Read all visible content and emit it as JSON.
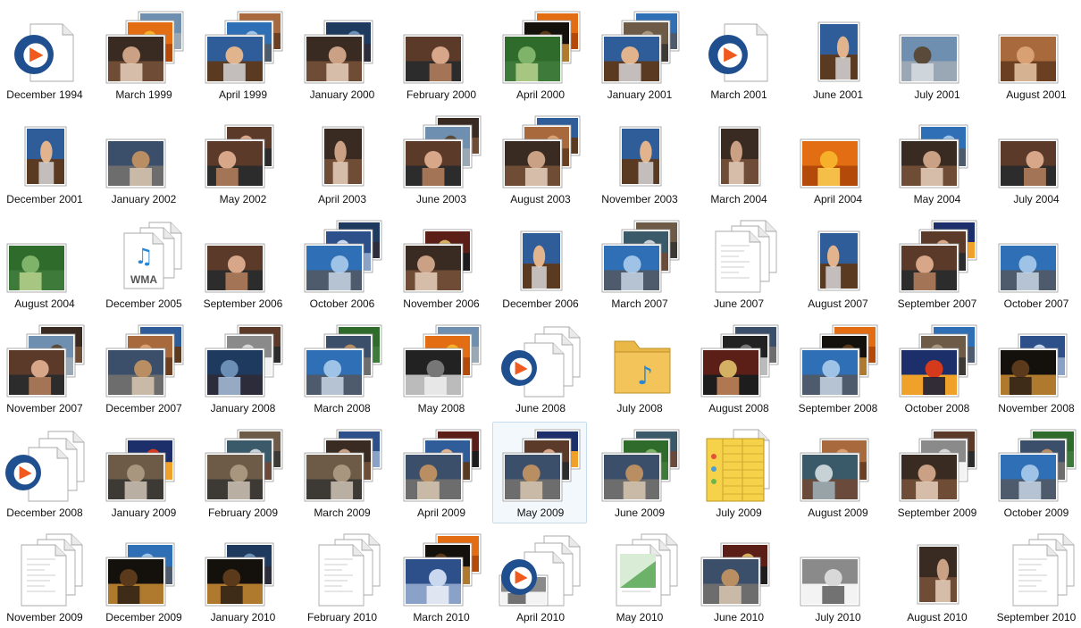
{
  "window": {
    "view": "Large icons"
  },
  "colors": {
    "selection_bg": "#f3f8fc",
    "selection_border": "#c7dcea",
    "folder": "#f2c45a",
    "media_blue": "#1f4f8f",
    "media_orange": "#f05a1e"
  },
  "selected_index": 49,
  "items": [
    {
      "label": "December 1994",
      "icon": "media-player-file-icon",
      "photos": 0,
      "kind": "media"
    },
    {
      "label": "March 1999",
      "icon": "photo-stack-icon",
      "photos": 3,
      "kind": "portrait"
    },
    {
      "label": "April 1999",
      "icon": "photo-stack-icon",
      "photos": 3,
      "kind": "child"
    },
    {
      "label": "January 2000",
      "icon": "photo-stack-icon",
      "photos": 2,
      "kind": "portrait"
    },
    {
      "label": "February 2000",
      "icon": "photo-stack-icon",
      "photos": 1,
      "kind": "people"
    },
    {
      "label": "April 2000",
      "icon": "photo-stack-icon",
      "photos": 3,
      "kind": "nature"
    },
    {
      "label": "January 2001",
      "icon": "photo-stack-icon",
      "photos": 3,
      "kind": "child"
    },
    {
      "label": "March 2001",
      "icon": "media-player-file-icon",
      "photos": 0,
      "kind": "media"
    },
    {
      "label": "June 2001",
      "icon": "photo-icon",
      "photos": 1,
      "kind": "child"
    },
    {
      "label": "July 2001",
      "icon": "photo-icon",
      "photos": 1,
      "kind": "outdoor"
    },
    {
      "label": "August 2001",
      "icon": "photo-icon",
      "photos": 1,
      "kind": "animal"
    },
    {
      "label": "December 2001",
      "icon": "photo-icon",
      "photos": 1,
      "kind": "child"
    },
    {
      "label": "January 2002",
      "icon": "photo-icon",
      "photos": 1,
      "kind": "indoor"
    },
    {
      "label": "May 2002",
      "icon": "photo-stack-icon",
      "photos": 2,
      "kind": "people"
    },
    {
      "label": "April 2003",
      "icon": "photo-icon",
      "photos": 1,
      "kind": "portrait"
    },
    {
      "label": "June 2003",
      "icon": "photo-stack-icon",
      "photos": 3,
      "kind": "people"
    },
    {
      "label": "August 2003",
      "icon": "photo-stack-icon",
      "photos": 3,
      "kind": "portrait"
    },
    {
      "label": "November 2003",
      "icon": "photo-icon",
      "photos": 1,
      "kind": "child"
    },
    {
      "label": "March 2004",
      "icon": "photo-icon",
      "photos": 1,
      "kind": "portrait"
    },
    {
      "label": "April 2004",
      "icon": "photo-icon",
      "photos": 1,
      "kind": "flowers"
    },
    {
      "label": "May 2004",
      "icon": "photo-stack-icon",
      "photos": 2,
      "kind": "portrait"
    },
    {
      "label": "July 2004",
      "icon": "photo-icon",
      "photos": 1,
      "kind": "people"
    },
    {
      "label": "August 2004",
      "icon": "photo-icon",
      "photos": 1,
      "kind": "nature"
    },
    {
      "label": "December 2005",
      "icon": "wma-audio-file-icon",
      "photos": 0,
      "kind": "wma",
      "badge": "WMA"
    },
    {
      "label": "September 2006",
      "icon": "photo-icon",
      "photos": 1,
      "kind": "people"
    },
    {
      "label": "October 2006",
      "icon": "photo-stack-icon",
      "photos": 3,
      "kind": "city"
    },
    {
      "label": "November 2006",
      "icon": "photo-stack-icon",
      "photos": 2,
      "kind": "portrait"
    },
    {
      "label": "December 2006",
      "icon": "photo-icon",
      "photos": 1,
      "kind": "child"
    },
    {
      "label": "March 2007",
      "icon": "photo-stack-icon",
      "photos": 3,
      "kind": "city"
    },
    {
      "label": "June 2007",
      "icon": "document-stack-icon",
      "photos": 0,
      "kind": "doc"
    },
    {
      "label": "August 2007",
      "icon": "photo-icon",
      "photos": 1,
      "kind": "child"
    },
    {
      "label": "September 2007",
      "icon": "photo-stack-icon",
      "photos": 3,
      "kind": "people"
    },
    {
      "label": "October 2007",
      "icon": "photo-icon",
      "photos": 1,
      "kind": "city"
    },
    {
      "label": "November 2007",
      "icon": "photo-stack-icon",
      "photos": 3,
      "kind": "people"
    },
    {
      "label": "December 2007",
      "icon": "photo-stack-icon",
      "photos": 3,
      "kind": "indoor"
    },
    {
      "label": "January 2008",
      "icon": "photo-stack-icon",
      "photos": 3,
      "kind": "water"
    },
    {
      "label": "March 2008",
      "icon": "photo-stack-icon",
      "photos": 3,
      "kind": "city"
    },
    {
      "label": "May 2008",
      "icon": "photo-stack-icon",
      "photos": 3,
      "kind": "bw"
    },
    {
      "label": "June 2008",
      "icon": "media-player-stack-icon",
      "photos": 0,
      "kind": "media-stack"
    },
    {
      "label": "July 2008",
      "icon": "music-folder-icon",
      "photos": 0,
      "kind": "folder"
    },
    {
      "label": "August 2008",
      "icon": "album-art-stack-icon",
      "photos": 3,
      "kind": "album"
    },
    {
      "label": "September 2008",
      "icon": "photo-stack-icon",
      "photos": 3,
      "kind": "city"
    },
    {
      "label": "October 2008",
      "icon": "album-art-stack-icon",
      "photos": 3,
      "kind": "album2"
    },
    {
      "label": "November 2008",
      "icon": "photo-stack-icon",
      "photos": 2,
      "kind": "night"
    },
    {
      "label": "December 2008",
      "icon": "media-player-stack-icon",
      "photos": 0,
      "kind": "media-stack"
    },
    {
      "label": "January 2009",
      "icon": "photo-stack-icon",
      "photos": 2,
      "kind": "construction"
    },
    {
      "label": "February 2009",
      "icon": "photo-stack-icon",
      "photos": 3,
      "kind": "construction"
    },
    {
      "label": "March 2009",
      "icon": "photo-stack-icon",
      "photos": 3,
      "kind": "construction"
    },
    {
      "label": "April 2009",
      "icon": "photo-stack-icon",
      "photos": 3,
      "kind": "indoor"
    },
    {
      "label": "May 2009",
      "icon": "photo-stack-icon",
      "photos": 3,
      "kind": "indoor"
    },
    {
      "label": "June 2009",
      "icon": "photo-stack-icon",
      "photos": 3,
      "kind": "indoor"
    },
    {
      "label": "July 2009",
      "icon": "spreadsheet-stack-icon",
      "photos": 0,
      "kind": "sheet"
    },
    {
      "label": "August 2009",
      "icon": "album-art-stack-icon",
      "photos": 2,
      "kind": "album3"
    },
    {
      "label": "September 2009",
      "icon": "photo-stack-icon",
      "photos": 3,
      "kind": "portrait"
    },
    {
      "label": "October 2009",
      "icon": "photo-stack-icon",
      "photos": 3,
      "kind": "city"
    },
    {
      "label": "November 2009",
      "icon": "document-stack-icon",
      "photos": 0,
      "kind": "doc2"
    },
    {
      "label": "December 2009",
      "icon": "photo-stack-icon",
      "photos": 2,
      "kind": "night"
    },
    {
      "label": "January 2010",
      "icon": "photo-stack-icon",
      "photos": 2,
      "kind": "night"
    },
    {
      "label": "February 2010",
      "icon": "document-stack-icon",
      "photos": 0,
      "kind": "doc3"
    },
    {
      "label": "March 2010",
      "icon": "photo-stack-icon",
      "photos": 3,
      "kind": "web"
    },
    {
      "label": "April 2010",
      "icon": "media-player-stack-icon",
      "photos": 1,
      "kind": "media-stack"
    },
    {
      "label": "May 2010",
      "icon": "document-stack-icon",
      "photos": 0,
      "kind": "doc4"
    },
    {
      "label": "June 2010",
      "icon": "photo-stack-icon",
      "photos": 2,
      "kind": "indoor"
    },
    {
      "label": "July 2010",
      "icon": "photo-stack-icon",
      "photos": 1,
      "kind": "animal2"
    },
    {
      "label": "August 2010",
      "icon": "photo-icon",
      "photos": 1,
      "kind": "portrait"
    },
    {
      "label": "September 2010",
      "icon": "document-stack-icon",
      "photos": 0,
      "kind": "doc5"
    }
  ]
}
